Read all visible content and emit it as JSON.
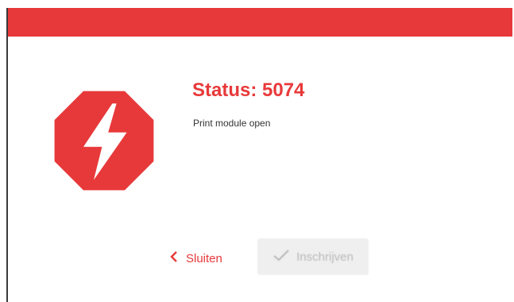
{
  "colors": {
    "accent": "#e8393a",
    "text": "#333333",
    "disabled_bg": "#efefef",
    "disabled_text": "#b9b9b9"
  },
  "dialog": {
    "icon": "power-bolt-stop-icon",
    "title": "Status: 5074",
    "message": "Print module open"
  },
  "actions": {
    "close_label": "Sluiten",
    "close_icon": "chevron-left-icon",
    "confirm_label": "Inschrijven",
    "confirm_icon": "checkmark-icon",
    "confirm_disabled": true
  }
}
